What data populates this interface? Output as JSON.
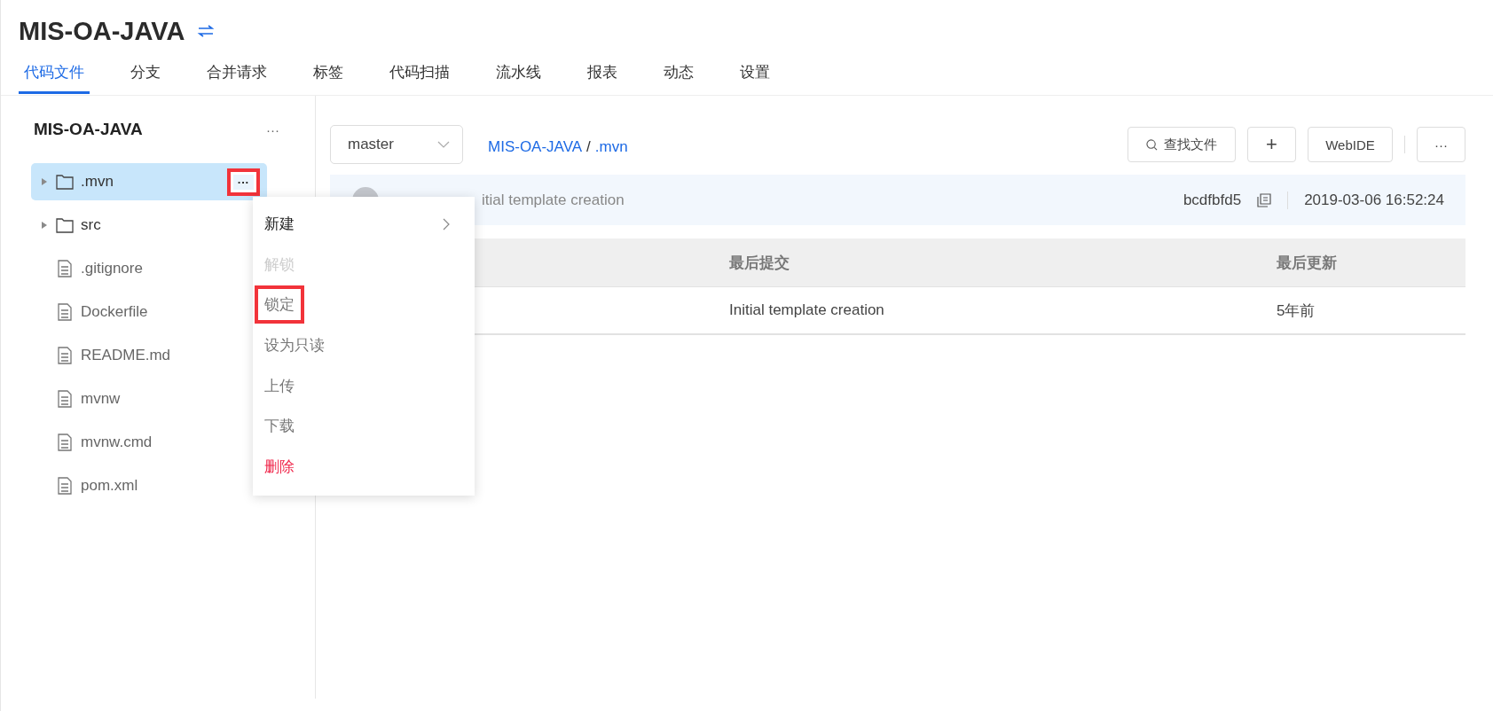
{
  "project": {
    "title": "MIS-OA-JAVA"
  },
  "tabs": [
    {
      "label": "代码文件",
      "selected": true
    },
    {
      "label": "分支",
      "selected": false
    },
    {
      "label": "合并请求",
      "selected": false
    },
    {
      "label": "标签",
      "selected": false
    },
    {
      "label": "代码扫描",
      "selected": false
    },
    {
      "label": "流水线",
      "selected": false
    },
    {
      "label": "报表",
      "selected": false
    },
    {
      "label": "动态",
      "selected": false
    },
    {
      "label": "设置",
      "selected": false
    }
  ],
  "sidebar": {
    "title": "MIS-OA-JAVA",
    "more": "···",
    "tree": [
      {
        "kind": "folder",
        "name": ".mvn",
        "selected": true,
        "more": "···",
        "highlighted": true
      },
      {
        "kind": "folder",
        "name": "src",
        "selected": false
      },
      {
        "kind": "file",
        "name": ".gitignore",
        "selected": false
      },
      {
        "kind": "file",
        "name": "Dockerfile",
        "selected": false
      },
      {
        "kind": "file",
        "name": "README.md",
        "selected": false
      },
      {
        "kind": "file",
        "name": "mvnw",
        "selected": false
      },
      {
        "kind": "file",
        "name": "mvnw.cmd",
        "selected": false
      },
      {
        "kind": "file",
        "name": "pom.xml",
        "selected": false
      }
    ]
  },
  "context_menu": {
    "items": [
      {
        "label": "新建",
        "kind": "submenu",
        "disabled": false,
        "highlighted": false
      },
      {
        "label": "解锁",
        "kind": "item",
        "disabled": true,
        "highlighted": false
      },
      {
        "label": "锁定",
        "kind": "item",
        "disabled": false,
        "highlighted": true
      },
      {
        "label": "设为只读",
        "kind": "item",
        "disabled": false,
        "highlighted": false
      },
      {
        "label": "上传",
        "kind": "item",
        "disabled": false,
        "highlighted": false
      },
      {
        "label": "下载",
        "kind": "item",
        "disabled": false,
        "highlighted": false
      },
      {
        "label": "删除",
        "kind": "danger",
        "disabled": false,
        "highlighted": false
      }
    ]
  },
  "toolbar": {
    "branch": "master",
    "breadcrumb": [
      "MIS-OA-JAVA",
      ".mvn"
    ],
    "separator": "/",
    "find_file": "查找文件",
    "add": "+",
    "webide": "WebIDE",
    "more": "···"
  },
  "commit": {
    "message": "itial template creation",
    "hash": "bcdfbfd5",
    "date": "2019-03-06 16:52:24"
  },
  "table": {
    "columns": [
      "最后提交",
      "最后更新"
    ],
    "rows": [
      [
        "Initial template creation",
        "5年前"
      ]
    ]
  }
}
